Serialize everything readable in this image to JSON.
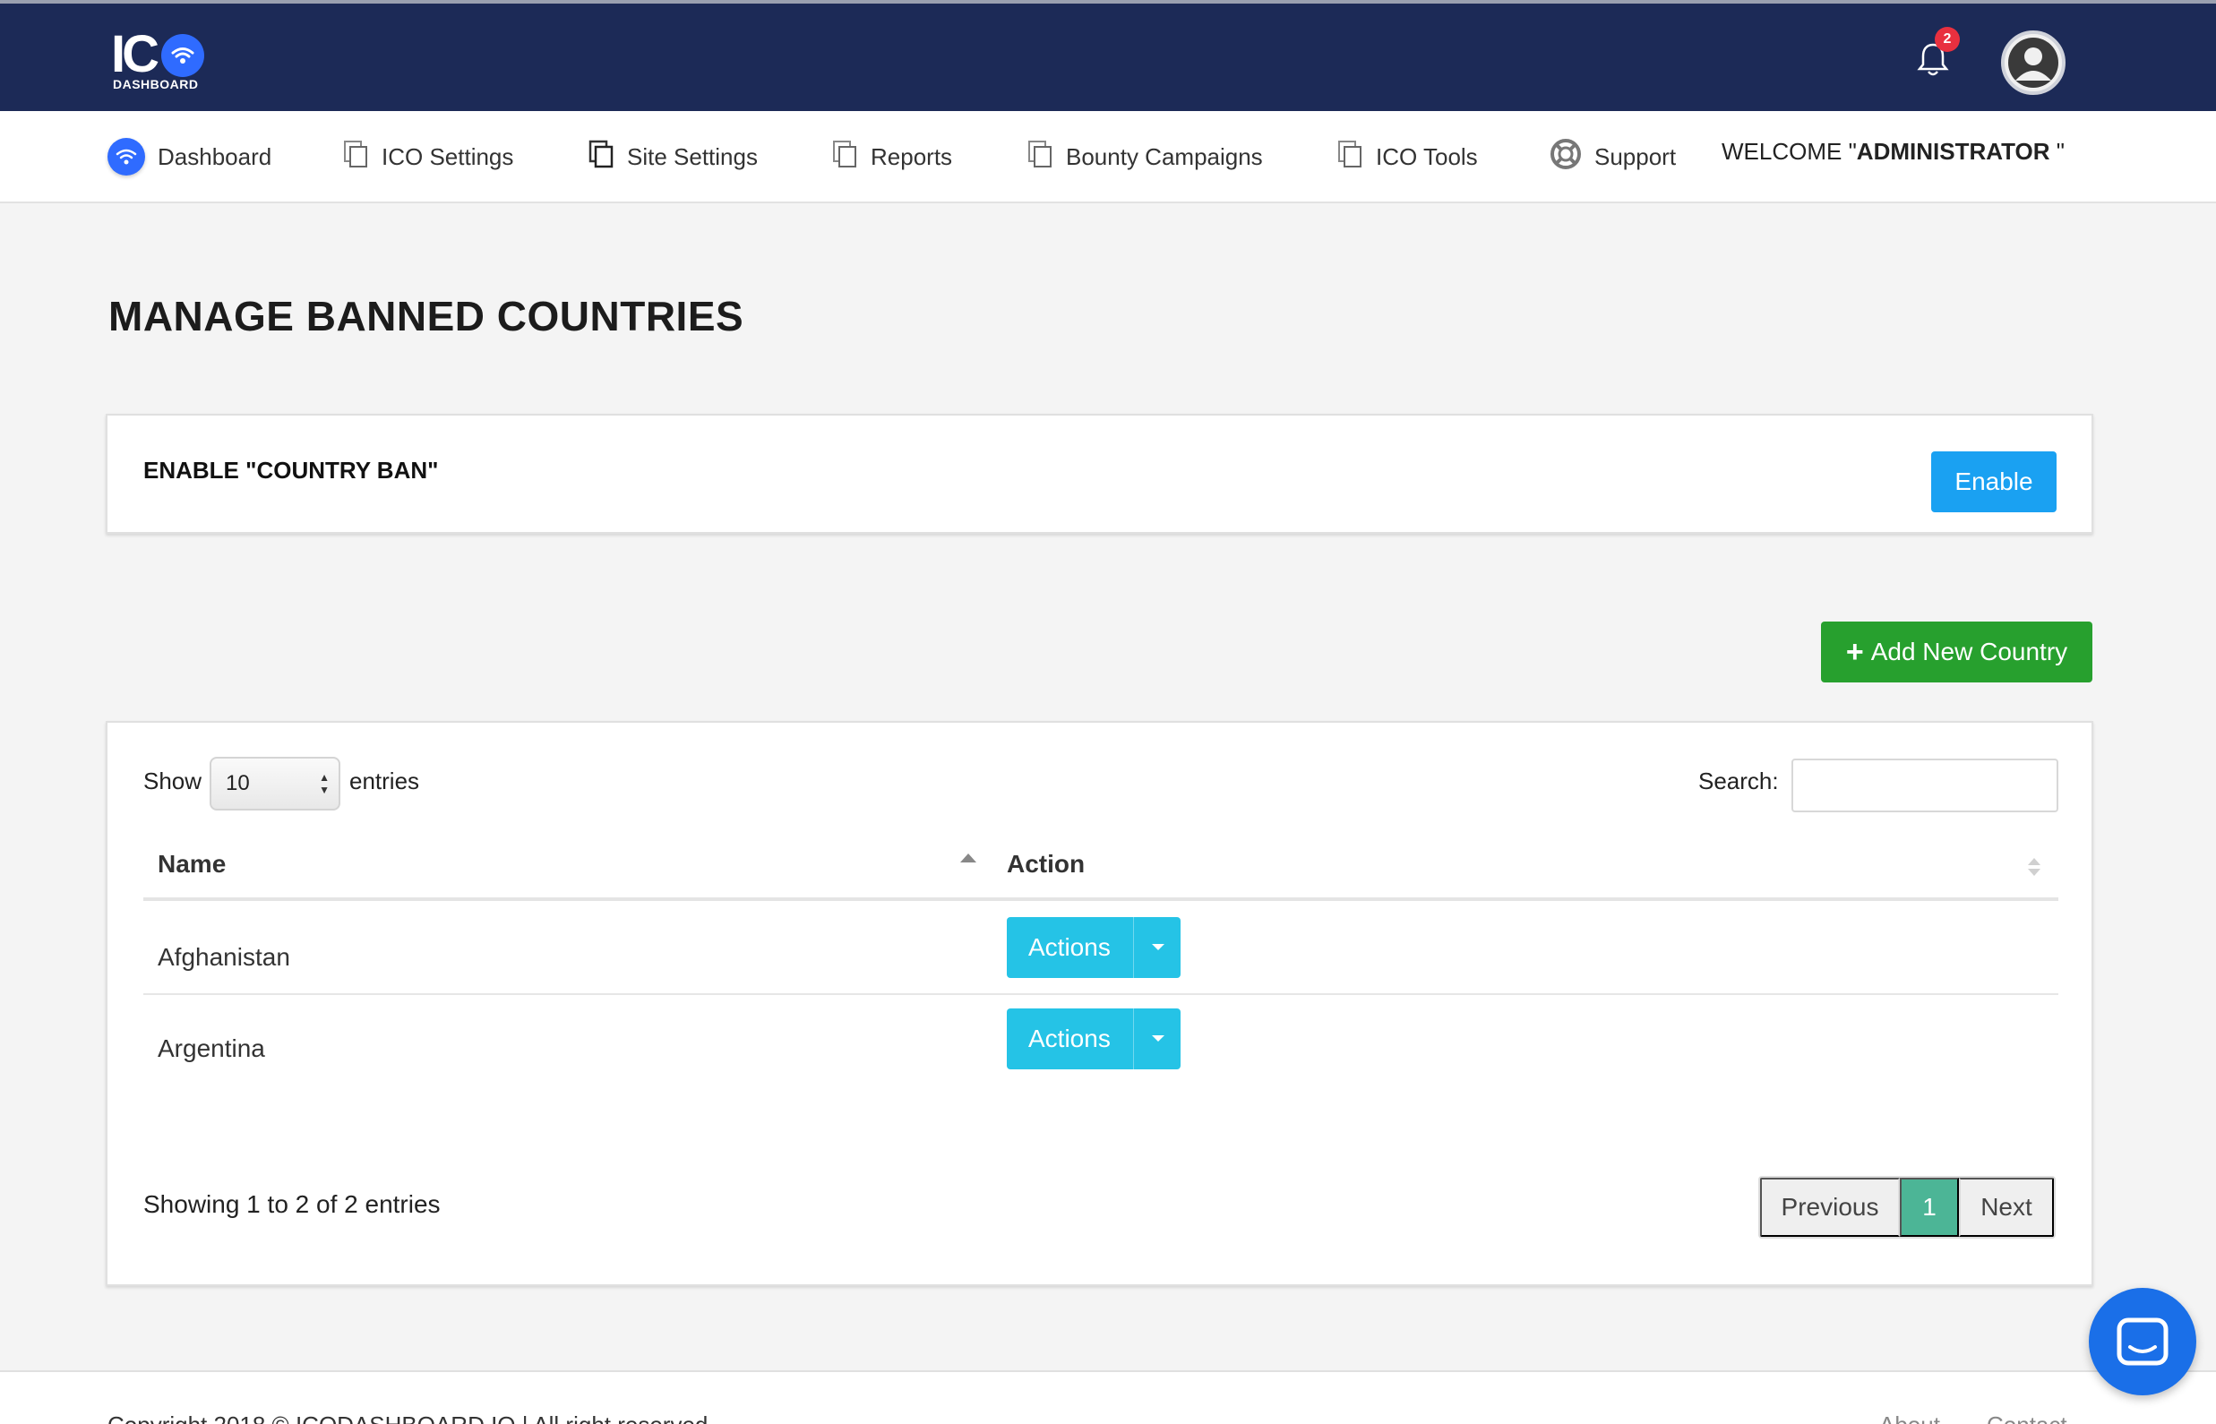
{
  "header": {
    "logo_text": "IC",
    "logo_sub": "DASHBOARD",
    "notification_count": "2"
  },
  "nav": {
    "items": [
      {
        "label": "Dashboard",
        "icon": "wifi-circle-icon"
      },
      {
        "label": "ICO Settings",
        "icon": "copy-icon"
      },
      {
        "label": "Site Settings",
        "icon": "copy-icon"
      },
      {
        "label": "Reports",
        "icon": "copy-icon"
      },
      {
        "label": "Bounty Campaigns",
        "icon": "copy-icon"
      },
      {
        "label": "ICO Tools",
        "icon": "copy-icon"
      },
      {
        "label": "Support",
        "icon": "lifebuoy-icon"
      }
    ],
    "welcome_prefix": "WELCOME \"",
    "welcome_name": "ADMINISTRATOR",
    "welcome_suffix": " \""
  },
  "page": {
    "title": "MANAGE BANNED COUNTRIES",
    "enable_label": "ENABLE \"COUNTRY BAN\"",
    "enable_button": "Enable",
    "add_button": "Add New Country"
  },
  "table": {
    "show_label": "Show",
    "entries_value": "10",
    "entries_label": "entries",
    "search_label": "Search:",
    "search_value": "",
    "columns": [
      "Name",
      "Action"
    ],
    "rows": [
      {
        "name": "Afghanistan",
        "action": "Actions"
      },
      {
        "name": "Argentina",
        "action": "Actions"
      }
    ],
    "showing_text": "Showing 1 to 2 of 2 entries",
    "pager": {
      "previous": "Previous",
      "current": "1",
      "next": "Next"
    }
  },
  "footer": {
    "copyright": "Copyright 2018 © ICODASHBOARD.IO | All right reserved",
    "links": [
      "About",
      "Contact"
    ]
  },
  "colors": {
    "header_bg": "#1c2a57",
    "enable_btn": "#1aa1f2",
    "add_btn": "#27a02e",
    "actions_btn": "#25c3e6",
    "pager_active": "#4cb596",
    "chat_bg": "#1a6fe8"
  }
}
